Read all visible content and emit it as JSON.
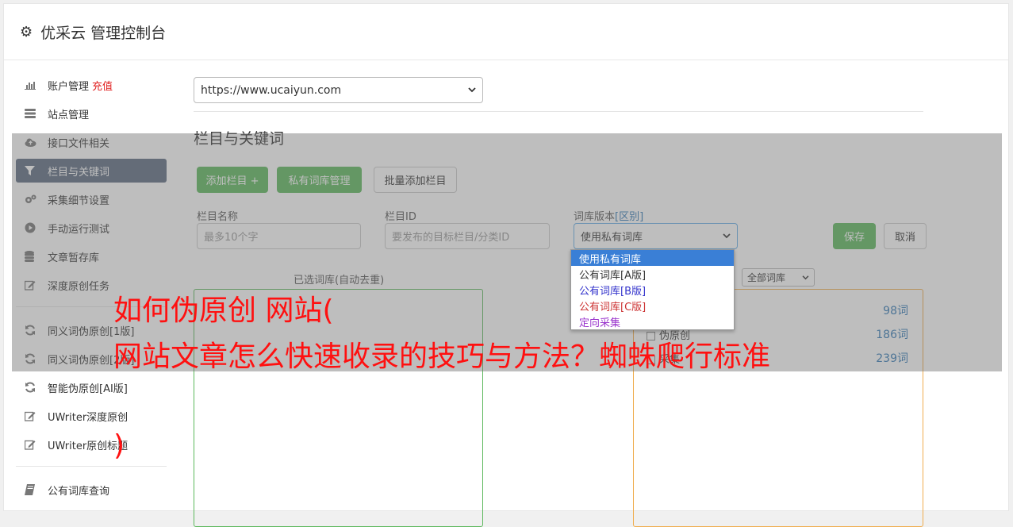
{
  "header": {
    "title": "优采云 管理控制台"
  },
  "sidebar": {
    "items": [
      {
        "label": "账户管理",
        "extra": "充值",
        "icon": "bar-chart-icon"
      },
      {
        "label": "站点管理",
        "icon": "server-icon"
      },
      {
        "label": "接口文件相关",
        "icon": "cloud-upload-icon"
      },
      {
        "label": "栏目与关键词",
        "icon": "filter-icon",
        "active": true
      },
      {
        "label": "采集细节设置",
        "icon": "cogs-icon"
      },
      {
        "label": "手动运行测试",
        "icon": "play-circle-icon"
      },
      {
        "label": "文章暂存库",
        "icon": "database-icon"
      },
      {
        "label": "深度原创任务",
        "icon": "edit-icon"
      }
    ],
    "items2": [
      {
        "label": "同义词伪原创[1版]",
        "icon": "refresh-icon"
      },
      {
        "label": "同义词伪原创[2版]",
        "icon": "refresh-icon"
      },
      {
        "label": "智能伪原创[AI版]",
        "icon": "refresh-icon"
      },
      {
        "label": "UWriter深度原创",
        "icon": "edit-icon"
      },
      {
        "label": "UWriter原创标题",
        "icon": "edit-icon"
      }
    ],
    "items3": [
      {
        "label": "公有词库查询",
        "icon": "book-icon"
      }
    ]
  },
  "main": {
    "site_select": "https://www.ucaiyun.com",
    "section_title": "栏目与关键词",
    "buttons": {
      "add_column": "添加栏目 +",
      "private_lib": "私有词库管理",
      "batch_add": "批量添加栏目",
      "save": "保存",
      "cancel": "取消"
    },
    "form": {
      "name_label": "栏目名称",
      "name_placeholder": "最多10个字",
      "id_label": "栏目ID",
      "id_placeholder": "要发布的目标栏目/分类ID",
      "version_label": "词库版本",
      "version_link": "[区别]",
      "version_value": "使用私有词库"
    },
    "dropdown": {
      "options": [
        {
          "label": "使用私有词库",
          "color": "#ffffff",
          "selected": true
        },
        {
          "label": "公有词库[A版]",
          "color": "#333333"
        },
        {
          "label": "公有词库[B版]",
          "color": "#3333cc"
        },
        {
          "label": "公有词库[C版]",
          "color": "#cc3333"
        },
        {
          "label": "定向采集",
          "color": "#9933cc"
        }
      ]
    },
    "left_panel_caption": "已选词库(自动去重)",
    "filter_select": "全部词库",
    "libraries": [
      {
        "name": "",
        "count": "98词"
      },
      {
        "name": "伪原创",
        "count": "186词"
      },
      {
        "name": "采集",
        "count": "239词"
      }
    ]
  },
  "watermark": {
    "line1": "如何伪原创 网站(",
    "line2": "网站文章怎么快速收录的技巧与方法？蜘蛛爬行标准",
    "line3": ")"
  }
}
